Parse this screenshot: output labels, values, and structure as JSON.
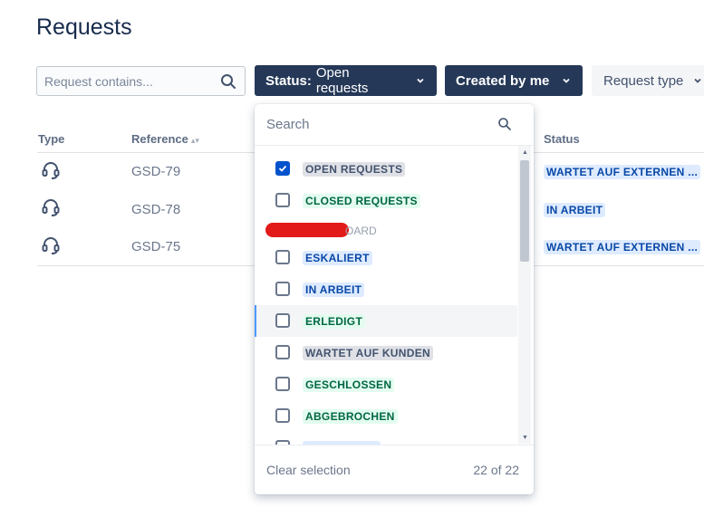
{
  "page": {
    "title": "Requests"
  },
  "search": {
    "placeholder": "Request contains..."
  },
  "filters": {
    "status_label": "Status:",
    "status_value": "Open requests",
    "created_label": "Created by me",
    "type_label": "Request type"
  },
  "table": {
    "headers": {
      "type": "Type",
      "reference": "Reference",
      "status": "Status"
    },
    "rows": [
      {
        "icon": "headset-icon",
        "reference": "GSD-79",
        "status": "WARTET AUF EXTERNEN ...",
        "status_color": "blue"
      },
      {
        "icon": "headset-icon",
        "reference": "GSD-78",
        "status": "IN ARBEIT",
        "status_color": "blue"
      },
      {
        "icon": "headset-icon",
        "reference": "GSD-75",
        "status": "WARTET AUF EXTERNEN ...",
        "status_color": "blue"
      }
    ]
  },
  "dropdown": {
    "search_placeholder": "Search",
    "options": [
      {
        "label": "OPEN REQUESTS",
        "checked": true,
        "style": "grey"
      },
      {
        "label": "CLOSED REQUESTS",
        "checked": false,
        "style": "green"
      },
      {
        "label": "OARD",
        "checked": false,
        "style": "redacted"
      },
      {
        "label": "ESKALIERT",
        "checked": false,
        "style": "blue"
      },
      {
        "label": "IN ARBEIT",
        "checked": false,
        "style": "blue"
      },
      {
        "label": "ERLEDIGT",
        "checked": false,
        "style": "green",
        "hover": true
      },
      {
        "label": "WARTET AUF KUNDEN",
        "checked": false,
        "style": "grey"
      },
      {
        "label": "GESCHLOSSEN",
        "checked": false,
        "style": "green"
      },
      {
        "label": "ABGEBROCHEN",
        "checked": false,
        "style": "green"
      }
    ],
    "clear_label": "Clear selection",
    "count_text": "22 of 22"
  },
  "colors": {
    "primary_dark": "#253858",
    "accent_blue": "#0052cc",
    "redaction": "#e21a1a"
  }
}
